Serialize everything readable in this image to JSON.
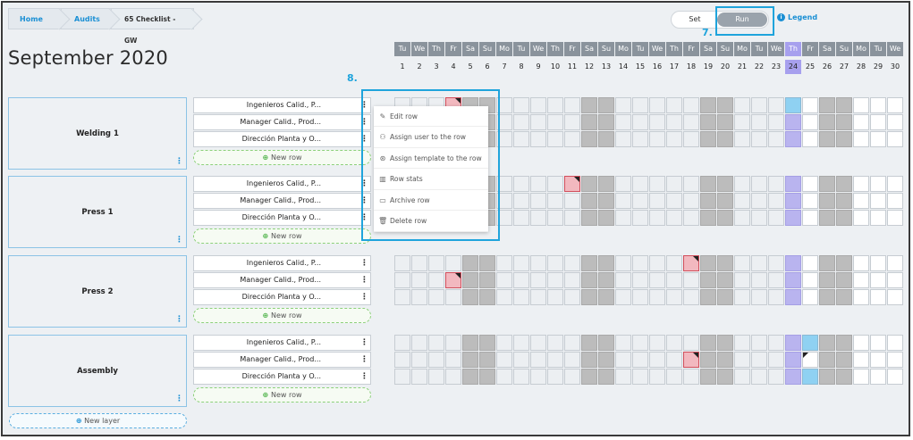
{
  "breadcrumb": [
    "Home",
    "Audits",
    "65 Checklist - GW"
  ],
  "mode_toggle": {
    "set_label": "Set",
    "run_label": "Run",
    "active": "Run"
  },
  "legend_label": "Legend",
  "legend_icon": "info-icon",
  "annotations": {
    "run_marker": "7.",
    "menu_marker": "8."
  },
  "month_title": "September 2020",
  "calendar": {
    "day_names": [
      "Tu",
      "We",
      "Th",
      "Fr",
      "Sa",
      "Su",
      "Mo",
      "Tu",
      "We",
      "Th",
      "Fr",
      "Sa",
      "Su",
      "Mo",
      "Tu",
      "We",
      "Th",
      "Fr",
      "Sa",
      "Su",
      "Mo",
      "Tu",
      "We",
      "Th",
      "Fr",
      "Sa",
      "Su",
      "Mo",
      "Tu",
      "We"
    ],
    "day_numbers": [
      "1",
      "2",
      "3",
      "4",
      "5",
      "6",
      "7",
      "8",
      "9",
      "10",
      "11",
      "12",
      "13",
      "14",
      "15",
      "16",
      "17",
      "18",
      "19",
      "20",
      "21",
      "22",
      "23",
      "24",
      "25",
      "26",
      "27",
      "28",
      "29",
      "30"
    ],
    "today": 24,
    "colors": {
      "weekend": "#bcbcbc",
      "today": "#b9b4ef",
      "overdue": "#f2b8bf",
      "done": "#8fd1f2",
      "future": "#ffffff"
    }
  },
  "layers": [
    {
      "name": "Welding 1",
      "rows": [
        "Ingenieros Calid., P...",
        "Manager Calid., Prod...",
        "Dirección Planta y O..."
      ]
    },
    {
      "name": "Press 1",
      "rows": [
        "Ingenieros Calid., P...",
        "Manager Calid., Prod...",
        "Dirección Planta y O..."
      ]
    },
    {
      "name": "Press 2",
      "rows": [
        "Ingenieros Calid., P...",
        "Manager Calid., Prod...",
        "Dirección Planta y O..."
      ]
    },
    {
      "name": "Assembly",
      "rows": [
        "Ingenieros Calid., P...",
        "Manager Calid., Prod...",
        "Dirección Planta y O..."
      ]
    }
  ],
  "new_row_label": "New row",
  "new_layer_label": "New layer",
  "cell_marks": [
    {
      "layer": 0,
      "row": 0,
      "day": 4,
      "state": "overdue"
    },
    {
      "layer": 0,
      "row": 0,
      "day": 24,
      "state": "done"
    },
    {
      "layer": 1,
      "row": 0,
      "day": 11,
      "state": "overdue"
    },
    {
      "layer": 2,
      "row": 0,
      "day": 18,
      "state": "overdue"
    },
    {
      "layer": 2,
      "row": 1,
      "day": 4,
      "state": "overdue"
    },
    {
      "layer": 3,
      "row": 0,
      "day": 25,
      "state": "done"
    },
    {
      "layer": 3,
      "row": 1,
      "day": 18,
      "state": "overdue"
    },
    {
      "layer": 3,
      "row": 1,
      "day": 25,
      "state": "flag"
    },
    {
      "layer": 3,
      "row": 2,
      "day": 25,
      "state": "done"
    }
  ],
  "context_menu": [
    {
      "label": "Edit row",
      "icon": "pencil-icon"
    },
    {
      "label": "Assign user to the row",
      "icon": "users-icon"
    },
    {
      "label": "Assign template to the row",
      "icon": "template-icon"
    },
    {
      "label": "Row stats",
      "icon": "chart-icon"
    },
    {
      "label": "Archive row",
      "icon": "folder-icon"
    },
    {
      "label": "Delete row",
      "icon": "trash-icon"
    }
  ]
}
